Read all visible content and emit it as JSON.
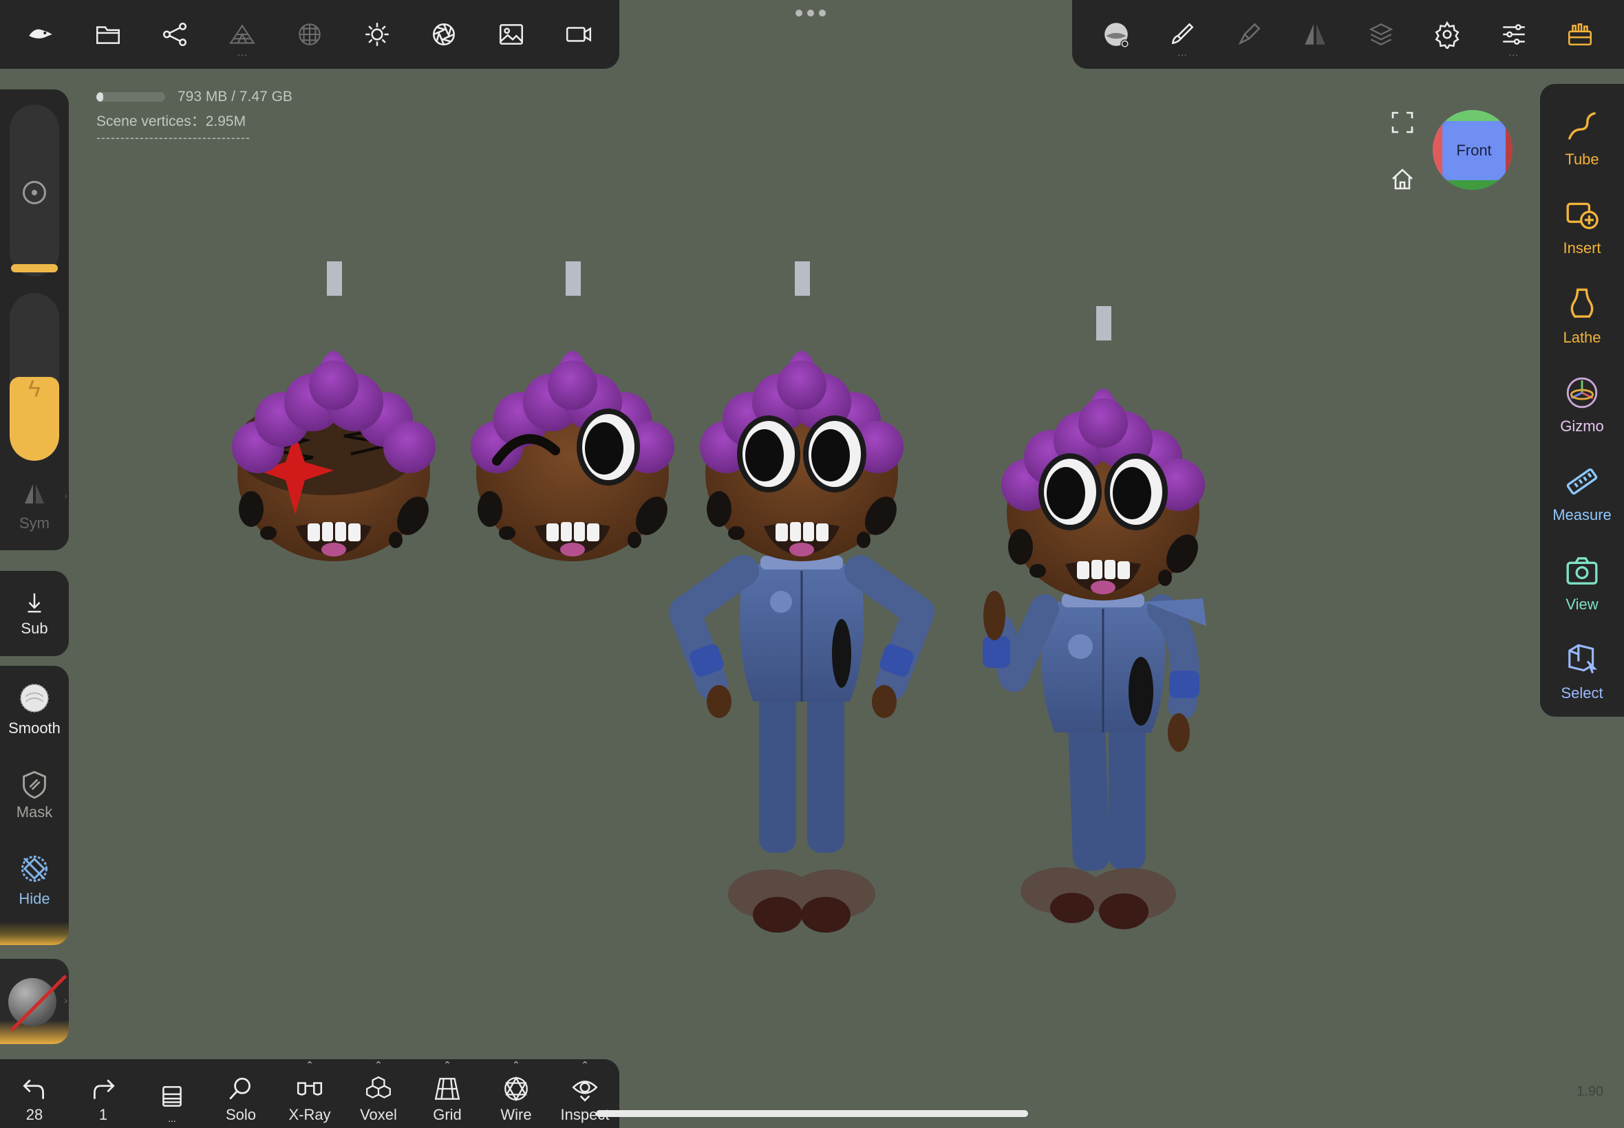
{
  "top_left_toolbar": {
    "items": [
      {
        "icon": "nomad-logo-icon"
      },
      {
        "icon": "folder-icon"
      },
      {
        "icon": "scene-graph-icon"
      },
      {
        "icon": "multires-icon"
      },
      {
        "icon": "topology-icon"
      },
      {
        "icon": "light-icon"
      },
      {
        "icon": "camera-aperture-icon"
      },
      {
        "icon": "image-icon"
      },
      {
        "icon": "video-camera-icon"
      }
    ]
  },
  "top_right_toolbar": {
    "items": [
      {
        "icon": "material-sphere-icon"
      },
      {
        "icon": "paint-brush-icon"
      },
      {
        "icon": "paint-stroke-icon"
      },
      {
        "icon": "symmetry-icon"
      },
      {
        "icon": "layers-icon"
      },
      {
        "icon": "settings-gear-icon"
      },
      {
        "icon": "sliders-icon"
      },
      {
        "icon": "toolbox-icon"
      }
    ]
  },
  "info": {
    "memory": "793 MB / 7.47 GB",
    "memory_fraction": 0.104,
    "scene_vertices": "Scene vertices：2.95M",
    "separator": "--------------------------------"
  },
  "left_sliders": {
    "radius_icon": "target-icon",
    "intensity_fraction": 0.5,
    "intensity_icon": "lightning-icon",
    "sym_label": "Sym"
  },
  "left_tools": {
    "sub": {
      "label": "Sub",
      "icon": "arrow-down-icon"
    },
    "smooth": {
      "label": "Smooth",
      "icon": "smooth-brush-icon"
    },
    "mask": {
      "label": "Mask",
      "icon": "mask-shield-icon"
    },
    "hide": {
      "label": "Hide",
      "icon": "hide-icon"
    }
  },
  "right_tools": [
    {
      "label": "Tube",
      "icon": "tube-curve-icon",
      "color": "#f2b33a"
    },
    {
      "label": "Insert",
      "icon": "insert-plus-icon",
      "color": "#f2b33a"
    },
    {
      "label": "Lathe",
      "icon": "lathe-vase-icon",
      "color": "#f2b33a"
    },
    {
      "label": "Gizmo",
      "icon": "gizmo-axes-icon",
      "color": "#e6c7f0"
    },
    {
      "label": "Measure",
      "icon": "ruler-icon",
      "color": "#8ec8ff"
    },
    {
      "label": "View",
      "icon": "camera-icon",
      "color": "#7ee0c8"
    },
    {
      "label": "Select",
      "icon": "select-box-icon",
      "color": "#9ab9ff"
    }
  ],
  "view_cube": {
    "face_label": "Front"
  },
  "bottom_toolbar": {
    "undo_count": "28",
    "redo_count": "1",
    "history_label": "...",
    "solo": "Solo",
    "xray": "X-Ray",
    "voxel": "Voxel",
    "grid": "Grid",
    "wire": "Wire",
    "inspect": "Inspect"
  },
  "version": "1.90",
  "colors": {
    "accent": "#efb94a",
    "panel": "#262626",
    "viewport": "#5a6256",
    "hair": "#8d3aa6",
    "skin": "#6b3f22",
    "suit": "#4a5f92"
  }
}
